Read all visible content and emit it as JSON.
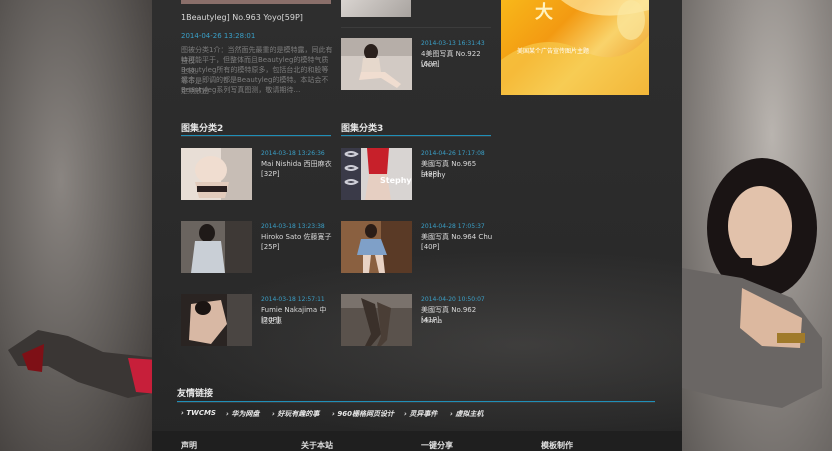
{
  "intro": {
    "title": "1Beautyleg] No.963 Yoyo[59P]",
    "date": "2014-04-26 13:28:01",
    "desc_line1": "图被分类1介：当然面先最重的是模特露，同此有些模",
    "desc_line2": "特可能平于，但整体而且Beautyleg的模特气质上较。",
    "desc_line3": "Beautyleg所有的模特原多，包括台北的和股等等不是",
    "desc_line4": "混合，即调的都是Beautyleg的模特。本站会不定期放出",
    "desc_line5": "Beautyleg系列写真图测，敬请期待…"
  },
  "col2_top": {
    "date": "2014-03-13 16:31:43",
    "title": "4美图写真 No.922 Vicni",
    "count": "[60P]"
  },
  "promo": {
    "text": "美国某个广告宣传图片主题",
    "corner": "大"
  },
  "section2": {
    "title": "图集分类2",
    "items": [
      {
        "date": "2014-03-18 13:26:36",
        "title": "Mai Nishida 西田麻衣",
        "count": "[32P]"
      },
      {
        "date": "2014-03-18 13:23:38",
        "title": "Hiroko Sato 佐藤寛子",
        "count": "[25P]"
      },
      {
        "date": "2014-03-18 12:57:11",
        "title": "Fumie Nakajima 中島史惠",
        "count": "[20P]"
      }
    ]
  },
  "section3": {
    "title": "图集分类3",
    "items": [
      {
        "date": "2014-04-26 17:17:08",
        "title": "美國写真 No.965 Stephy",
        "count": "[49P]",
        "overlay": "Stephy"
      },
      {
        "date": "2014-04-28 17:05:37",
        "title": "美國写真 No.964 Chu",
        "count": "[40P]"
      },
      {
        "date": "2014-04-20 10:50:07",
        "title": "美國写真 No.962 Minna",
        "count": "[41P]"
      }
    ]
  },
  "friend_links": {
    "title": "友情链接",
    "items": [
      "TWCMS",
      "华为网盘",
      "好玩有趣的事",
      "960栅格网页设计",
      "灵异事件",
      "虚拟主机"
    ]
  },
  "footer": {
    "items": [
      "声明",
      "关于本站",
      "一键分享",
      "模板制作"
    ]
  },
  "colors": {
    "accent": "#1f8fb8",
    "date": "#3aa0c8",
    "panel": "#2b2b2b"
  }
}
